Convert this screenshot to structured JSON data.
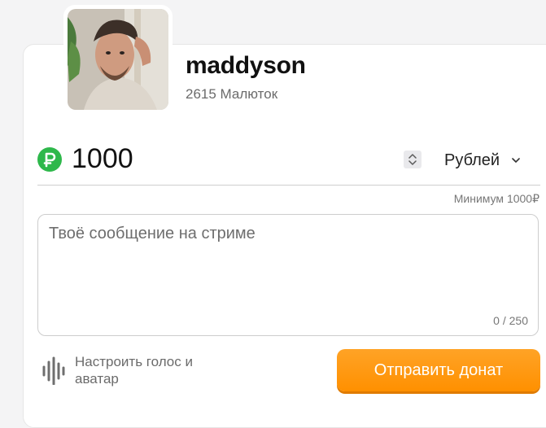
{
  "streamer": {
    "username": "maddyson",
    "subscribers": "2615 Малюток",
    "avatar_icon": "streamer-avatar-photo"
  },
  "donation": {
    "currency_icon": "ruble-icon",
    "amount_value": "1000",
    "currency_selected": "Рублей",
    "minimum_hint": "Минимум 1000₽",
    "message_placeholder": "Твоё сообщение на стриме",
    "message_value": "",
    "char_counter": "0 / 250"
  },
  "voice": {
    "icon": "sound-wave-icon",
    "label": "Настроить голос и аватар"
  },
  "actions": {
    "send_label": "Отправить донат"
  },
  "colors": {
    "accent": "#ff9800",
    "ruble_badge": "#2eb84b"
  }
}
